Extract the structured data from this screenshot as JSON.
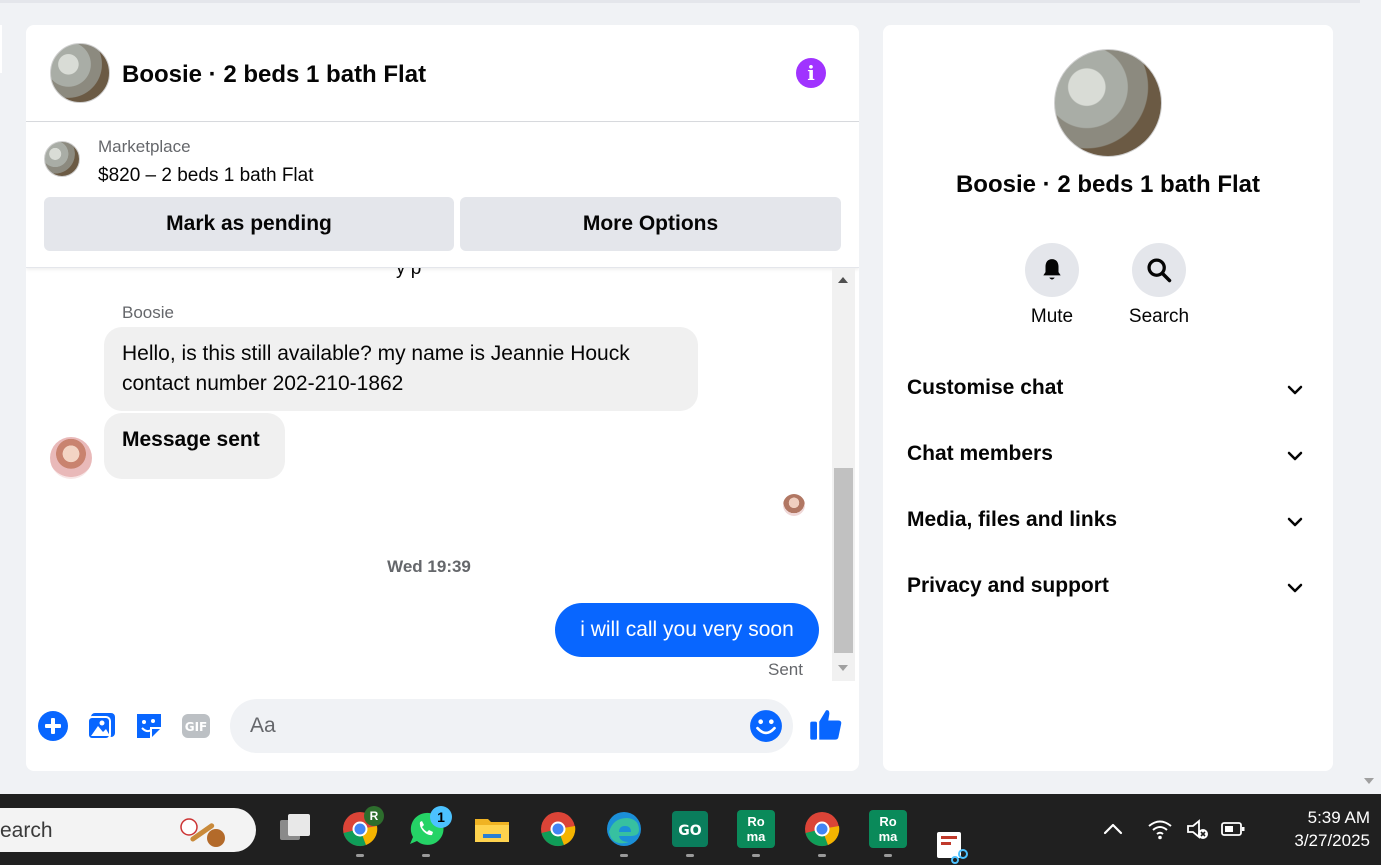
{
  "chat": {
    "title": "Boosie · 2 beds 1 bath Flat",
    "info_icon": "info-icon",
    "marketplace": {
      "label": "Marketplace",
      "listing": "$820 – 2 beds 1 bath Flat",
      "mark_pending": "Mark as pending",
      "more_options": "More Options"
    },
    "messages": {
      "clipped": "y p",
      "sender": "Boosie",
      "incoming_1": "Hello, is this still available? my name is Jeannie Houck contact number 202-210-1862",
      "incoming_2": "Message sent",
      "timestamp": "Wed 19:39",
      "outgoing": "i will call you very soon",
      "status": "Sent"
    },
    "composer": {
      "placeholder": "Aa",
      "icons": [
        "plus-circle-icon",
        "photo-icon",
        "sticker-icon",
        "gif-icon",
        "emoji-icon",
        "thumbs-up-icon"
      ]
    },
    "accent_color": "#0866ff"
  },
  "info": {
    "title": "Boosie · 2 beds 1 bath Flat",
    "mute_label": "Mute",
    "search_label": "Search",
    "sections": [
      "Customise chat",
      "Chat members",
      "Media, files and links",
      "Privacy and support"
    ]
  },
  "taskbar": {
    "search_text": "earch",
    "chrome_badge": "R",
    "whatsapp_badge": "1",
    "roma_label_1": "Ro",
    "roma_label_2": "ma",
    "time": "5:39 AM",
    "date": "3/27/2025"
  }
}
